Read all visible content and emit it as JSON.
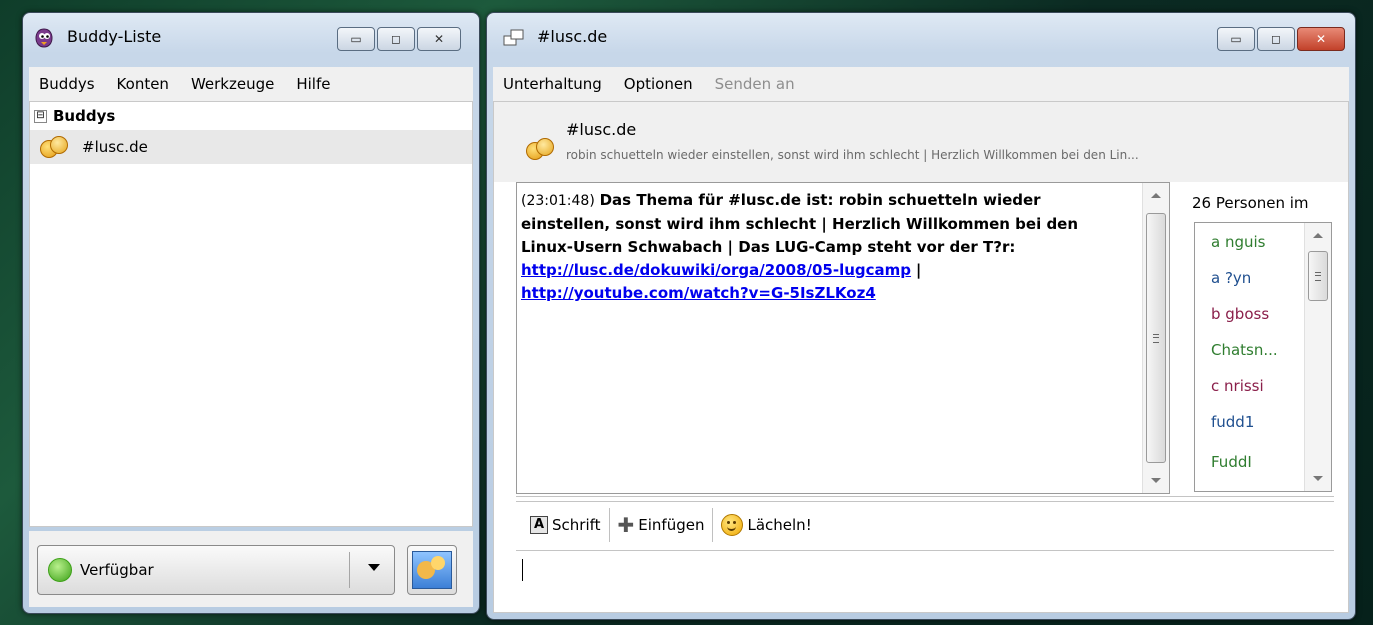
{
  "buddy_window": {
    "title": "Buddy-Liste",
    "menu": [
      {
        "label": "Buddys",
        "mnemonic": "B"
      },
      {
        "label": "Konten",
        "mnemonic": "K"
      },
      {
        "label": "Werkzeuge",
        "mnemonic": "W"
      },
      {
        "label": "Hilfe",
        "mnemonic": "H"
      }
    ],
    "group": {
      "expander": "⊟",
      "label": "Buddys"
    },
    "buddy": {
      "name": "#lusc.de",
      "icon": "people-icon"
    },
    "status": {
      "label": "Verfügbar",
      "color": "#3da118"
    }
  },
  "chat_window": {
    "title": "#lusc.de",
    "menu": [
      {
        "label": "Unterhaltung",
        "enabled": true
      },
      {
        "label": "Optionen",
        "enabled": true
      },
      {
        "label": "Senden an",
        "enabled": false
      }
    ],
    "header": {
      "name": "#lusc.de",
      "topic": "robin schuetteln wieder einstellen, sonst wird ihm schlecht | Herzlich Willkommen bei den Lin..."
    },
    "log": {
      "timestamp": "(23:01:48)",
      "message": "Das Thema für #lusc.de ist: robin schuetteln wieder einstellen, sonst wird ihm schlecht | Herzlich Willkommen bei den Linux-Usern Schwabach | Das LUG-Camp steht vor der T?r:",
      "link1": "http://lusc.de/dokuwiki/orga/2008/05-lugcamp",
      "separator": "|",
      "link2": "http://youtube.com/watch?v=G-5IsZLKoz4"
    },
    "user_count": "26 Personen im",
    "users": [
      {
        "name": "a nguis",
        "color": "#2f7d2f"
      },
      {
        "name": "a ?yn",
        "color": "#1f4f8f"
      },
      {
        "name": "b gboss",
        "color": "#8a1f4a"
      },
      {
        "name": "Chatsn...",
        "color": "#2f7d2f"
      },
      {
        "name": "c nrissi",
        "color": "#8a1f4a"
      },
      {
        "name": "fudd1",
        "color": "#1f4f8f"
      },
      {
        "name": "FuddI",
        "color": "#2f7d2f"
      }
    ],
    "toolbar": {
      "font": "Schrift",
      "insert": "Einfügen",
      "smile": "Lächeln!"
    },
    "input": ""
  }
}
